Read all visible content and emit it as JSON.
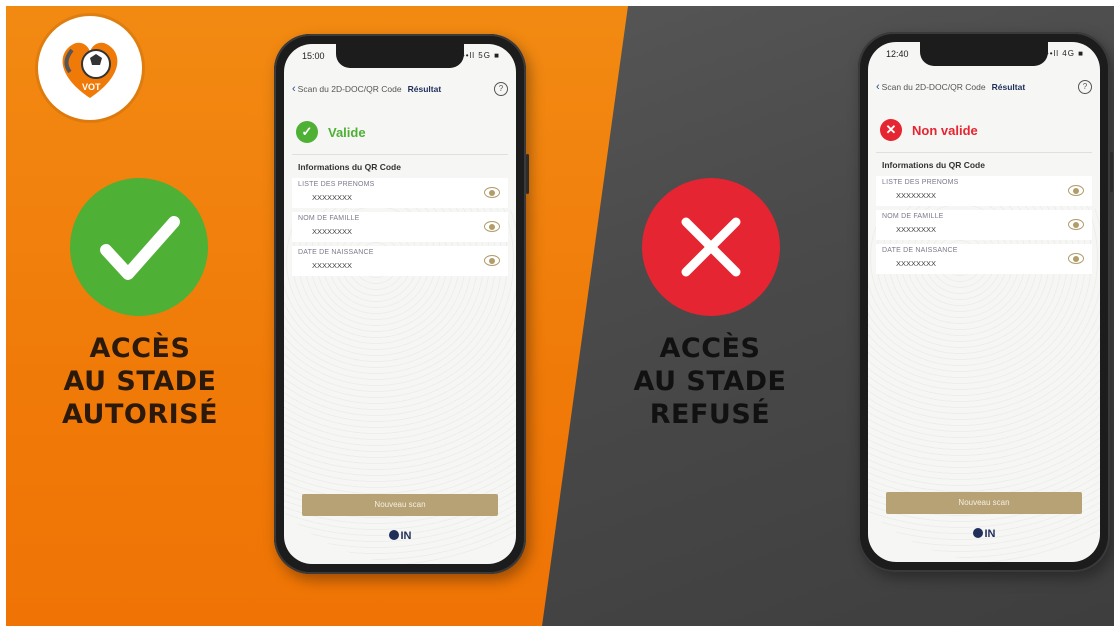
{
  "colors": {
    "orange": "#f07a08",
    "gray": "#4a4a4a",
    "valid_green": "#4eb035",
    "invalid_red": "#e52531",
    "button_gold": "#b6a274",
    "navy": "#1f2f5a"
  },
  "logo": {
    "icon": "football-heart-logo",
    "text": "VOT"
  },
  "left": {
    "caption_lines": [
      "ACCÈS",
      "AU STADE",
      "AUTORISÉ"
    ],
    "big_icon": "check-icon",
    "phone": {
      "time": "15:00",
      "signal": "••ll 5G ■",
      "back_label": "Scan du 2D-DOC/QR Code",
      "title": "Résultat",
      "status_text": "Valide",
      "status_icon": "check-circle-icon",
      "section_title": "Informations du QR Code",
      "fields": [
        {
          "label": "LISTE DES PRENOMS",
          "value": "XXXXXXXX"
        },
        {
          "label": "NOM DE FAMILLE",
          "value": "XXXXXXXX"
        },
        {
          "label": "DATE DE NAISSANCE",
          "value": "XXXXXXXX"
        }
      ],
      "scan_button": "Nouveau scan",
      "brand": "IN"
    }
  },
  "right": {
    "caption_lines": [
      "ACCÈS",
      "AU STADE",
      "REFUSÉ"
    ],
    "big_icon": "close-icon",
    "phone": {
      "time": "12:40",
      "signal": "••ll 4G ■",
      "back_label": "Scan du 2D-DOC/QR Code",
      "title": "Résultat",
      "status_text": "Non valide",
      "status_icon": "x-circle-icon",
      "section_title": "Informations du QR Code",
      "fields": [
        {
          "label": "LISTE DES PRENOMS",
          "value": "XXXXXXXX"
        },
        {
          "label": "NOM DE FAMILLE",
          "value": "XXXXXXXX"
        },
        {
          "label": "DATE DE NAISSANCE",
          "value": "XXXXXXXX"
        }
      ],
      "scan_button": "Nouveau scan",
      "brand": "IN"
    }
  }
}
